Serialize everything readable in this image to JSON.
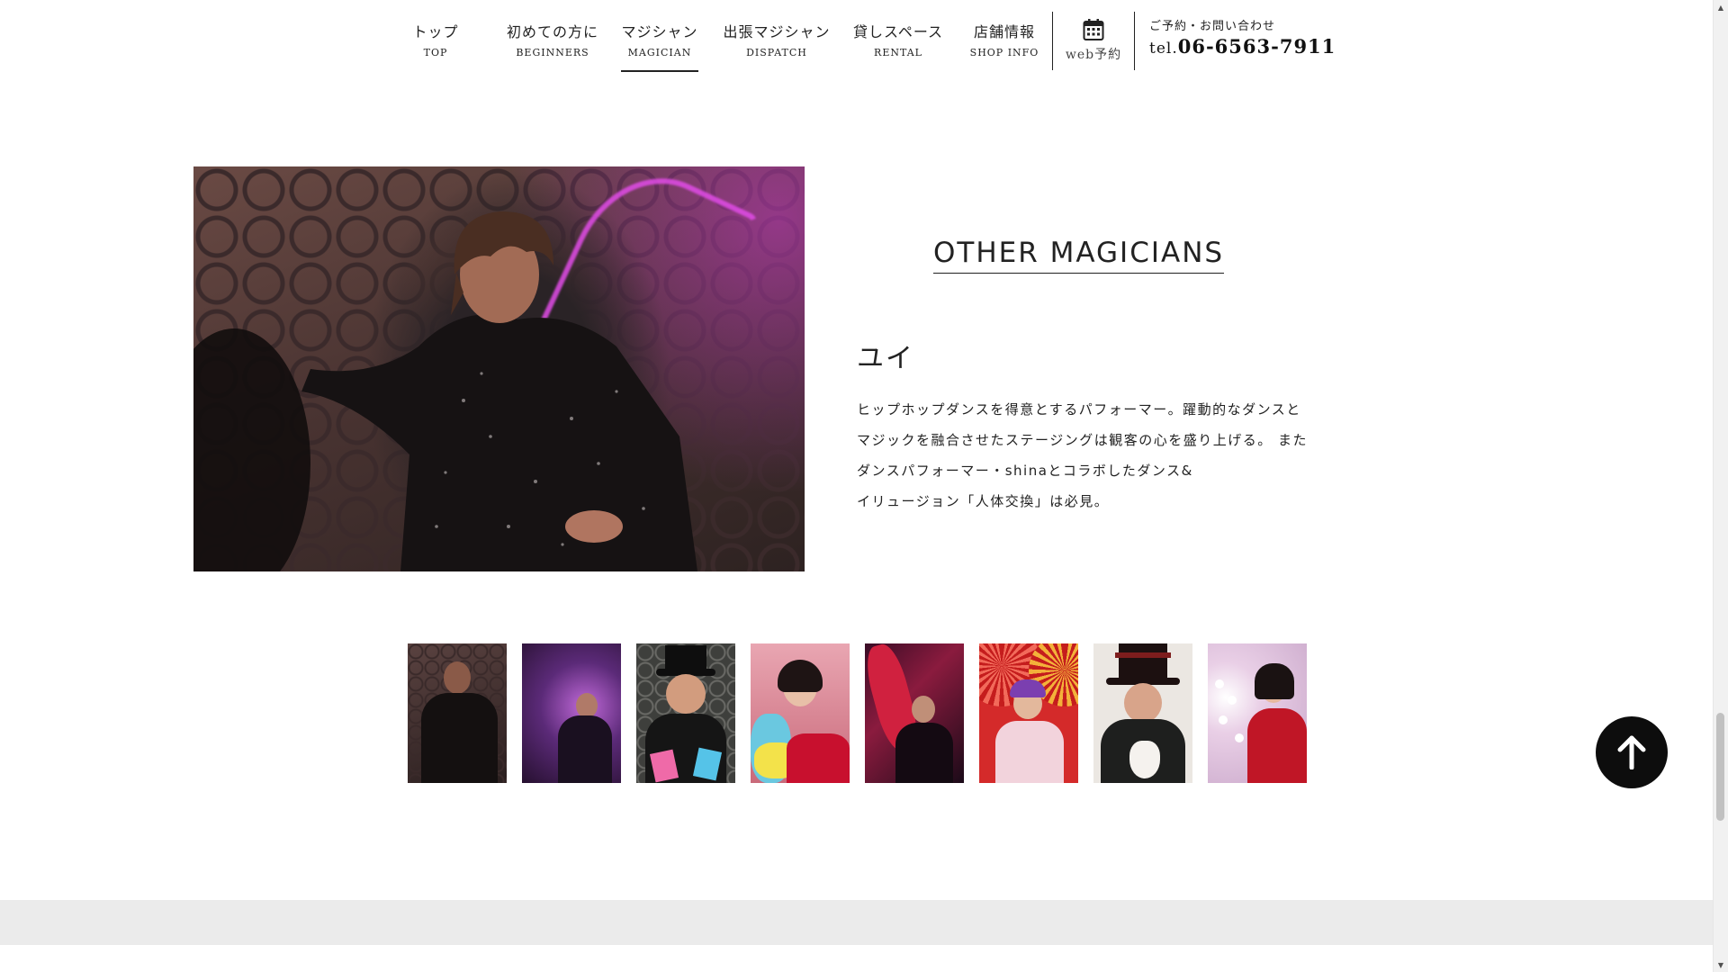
{
  "nav": {
    "items": [
      {
        "jp": "トップ",
        "en": "TOP"
      },
      {
        "jp": "初めての方に",
        "en": "BEGINNERS"
      },
      {
        "jp": "マジシャン",
        "en": "MAGICIAN"
      },
      {
        "jp": "出張マジシャン",
        "en": "DISPATCH"
      },
      {
        "jp": "貸しスペース",
        "en": "RENTAL"
      },
      {
        "jp": "店舗情報",
        "en": "SHOP INFO"
      }
    ],
    "active_index": 2,
    "web_reserve_label": "web予約",
    "contact_label": "ご予約・お問い合わせ",
    "tel_prefix": "tel.",
    "tel_number": "06-6563-7911"
  },
  "feature": {
    "section_title": "OTHER MAGICIANS",
    "name": "ユイ",
    "description_lines": [
      "ヒップホップダンスを得意とするパフォーマー。躍動的なダンスと",
      "マジックを融合させたステージングは観客の心を盛り上げる。 また",
      "ダンスパフォーマー・shinaとコラボしたダンス&",
      "イリュージョン「人体交換」は必見。"
    ]
  },
  "thumbnails_count": 8,
  "icons": {
    "calendar": "calendar-icon",
    "back_to_top": "arrow-up-icon"
  }
}
